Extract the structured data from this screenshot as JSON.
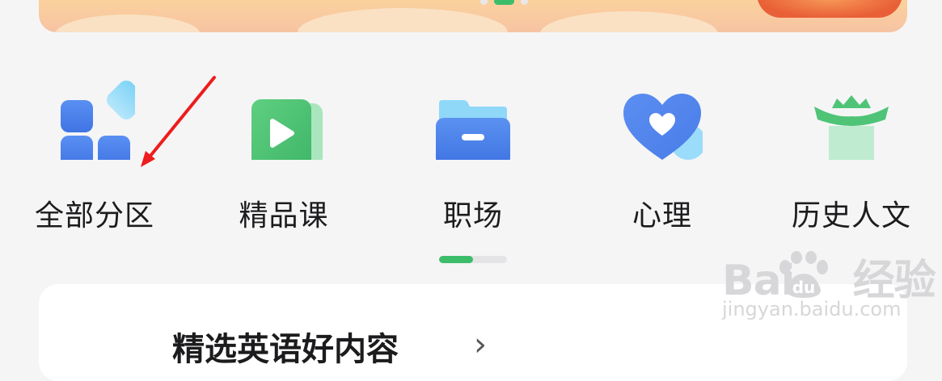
{
  "banner": {
    "carousel_active_index": 1,
    "carousel_count": 3
  },
  "categories": [
    {
      "label": "全部分区",
      "icon": "grid-icon"
    },
    {
      "label": "精品课",
      "icon": "play-icon"
    },
    {
      "label": "职场",
      "icon": "folder-icon"
    },
    {
      "label": "心理",
      "icon": "heart-icon"
    },
    {
      "label": "历史人文",
      "icon": "pavilion-icon"
    }
  ],
  "category_scroll": {
    "progress": 0.5
  },
  "featured": {
    "title": "精选英语好内容",
    "chevron": "›"
  },
  "watermark": {
    "brand": "Bai",
    "brand_suffix": "经验",
    "url": "jingyan.baidu.com"
  },
  "colors": {
    "accent_green": "#3dbd6a",
    "icon_blue": "#4f86ee",
    "annotation_red": "#ee1c1c"
  }
}
